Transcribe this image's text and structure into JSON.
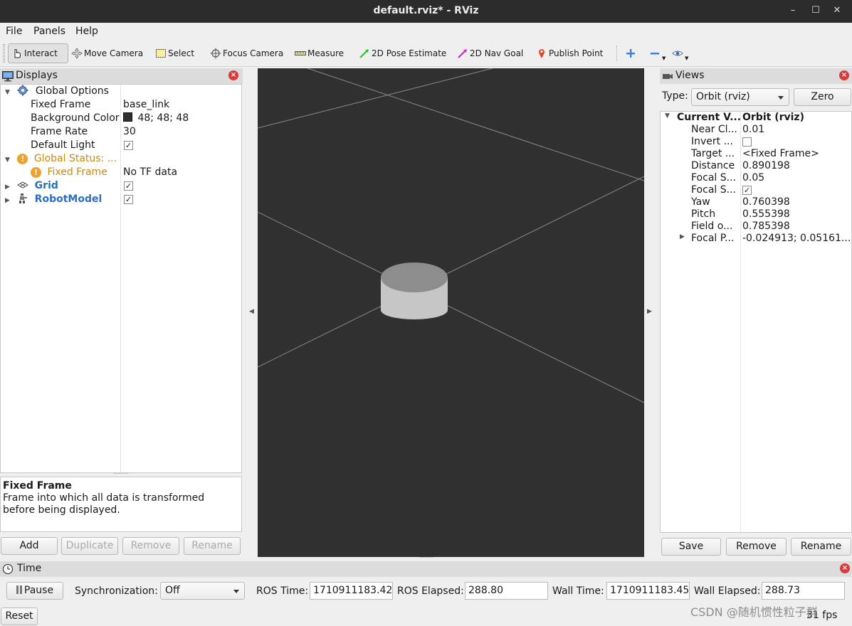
{
  "window": {
    "title": "default.rviz* - RViz",
    "buttons": [
      "–",
      "☐",
      "✕"
    ]
  },
  "menu": [
    "File",
    "Panels",
    "Help"
  ],
  "toolbar": {
    "tools": [
      {
        "label": "Interact",
        "icon": "hand-pointer-icon",
        "active": true
      },
      {
        "label": "Move Camera",
        "icon": "move-camera-icon"
      },
      {
        "label": "Select",
        "icon": "select-rectangle-icon"
      },
      {
        "label": "Focus Camera",
        "icon": "focus-camera-icon"
      },
      {
        "label": "Measure",
        "icon": "ruler-icon"
      },
      {
        "label": "2D Pose Estimate",
        "icon": "green-arrow-icon"
      },
      {
        "label": "2D Nav Goal",
        "icon": "magenta-arrow-icon"
      },
      {
        "label": "Publish Point",
        "icon": "map-pin-icon"
      }
    ]
  },
  "displays": {
    "title": "Displays",
    "global_options": {
      "label": "Global Options",
      "fixed_frame": {
        "key": "Fixed Frame",
        "value": "base_link"
      },
      "background_color": {
        "key": "Background Color",
        "value": "48; 48; 48",
        "swatch": "#303030"
      },
      "frame_rate": {
        "key": "Frame Rate",
        "value": "30"
      },
      "default_light": {
        "key": "Default Light",
        "checked": true
      }
    },
    "global_status": {
      "label": "Global Status: ...",
      "fixed_frame": {
        "key": "Fixed Frame",
        "value": "No TF data"
      }
    },
    "grid": {
      "label": "Grid",
      "checked": true
    },
    "robot_model": {
      "label": "RobotModel",
      "checked": true
    },
    "description": {
      "title": "Fixed Frame",
      "text": "Frame into which all data is transformed before being displayed."
    },
    "buttons": {
      "add": "Add",
      "duplicate": "Duplicate",
      "remove": "Remove",
      "rename": "Rename"
    }
  },
  "views": {
    "title": "Views",
    "type_label": "Type:",
    "type_value": "Orbit (rviz)",
    "zero": "Zero",
    "current": {
      "key": "Current V...",
      "value": "Orbit (rviz)"
    },
    "props": [
      {
        "key": "Near Cl...",
        "value": "0.01"
      },
      {
        "key": "Invert ...",
        "value": "",
        "checkbox": true,
        "checked": false
      },
      {
        "key": "Target ...",
        "value": "<Fixed Frame>"
      },
      {
        "key": "Distance",
        "value": "0.890198"
      },
      {
        "key": "Focal S...",
        "value": "0.05"
      },
      {
        "key": "Focal S...",
        "value": "",
        "checkbox": true,
        "checked": true
      },
      {
        "key": "Yaw",
        "value": "0.760398"
      },
      {
        "key": "Pitch",
        "value": "0.555398"
      },
      {
        "key": "Field o...",
        "value": "0.785398"
      },
      {
        "key": "Focal P...",
        "value": "-0.024913; 0.05161...",
        "expandable": true
      }
    ],
    "buttons": {
      "save": "Save",
      "remove": "Remove",
      "rename": "Rename"
    }
  },
  "time": {
    "title": "Time",
    "pause": "Pause",
    "sync_label": "Synchronization:",
    "sync_value": "Off",
    "ros_time_label": "ROS Time:",
    "ros_time": "1710911183.42",
    "ros_elapsed_label": "ROS Elapsed:",
    "ros_elapsed": "288.80",
    "wall_time_label": "Wall Time:",
    "wall_time": "1710911183.45",
    "wall_elapsed_label": "Wall Elapsed:",
    "wall_elapsed": "288.73",
    "reset": "Reset",
    "fps": "31 fps",
    "watermark": "CSDN @随机惯性粒子群"
  },
  "viewport": {
    "background": "#303030"
  }
}
